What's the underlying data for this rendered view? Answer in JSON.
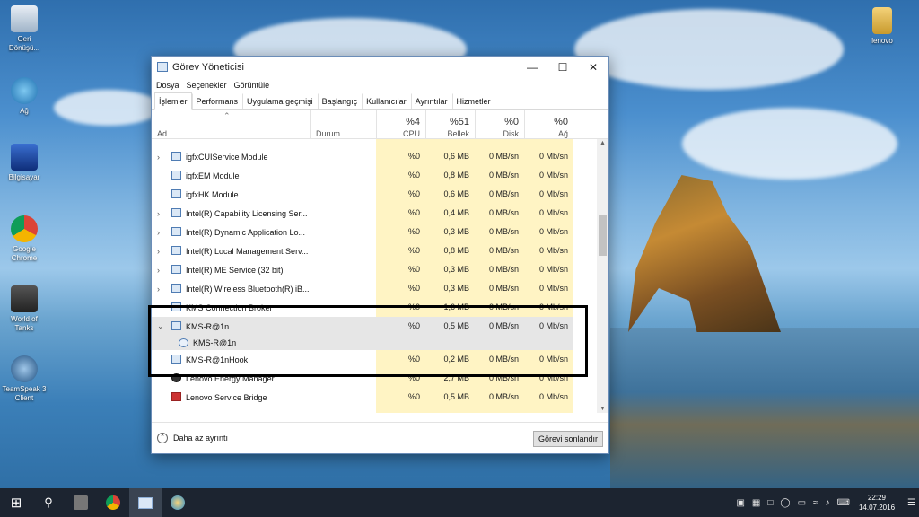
{
  "desktop": {
    "icons_left": [
      {
        "label": "Geri Dönüşü..."
      },
      {
        "label": "Ağ"
      },
      {
        "label": "Bilgisayar"
      },
      {
        "label": "Google Chrome"
      },
      {
        "label": "World of Tanks"
      },
      {
        "label": "TeamSpeak 3 Client"
      }
    ],
    "icon_right": {
      "label": "lenovo"
    }
  },
  "window": {
    "title": "Görev Yöneticisi",
    "menu": [
      "Dosya",
      "Seçenekler",
      "Görüntüle"
    ],
    "tabs": [
      "İşlemler",
      "Performans",
      "Uygulama geçmişi",
      "Başlangıç",
      "Kullanıcılar",
      "Ayrıntılar",
      "Hizmetler"
    ],
    "active_tab": "İşlemler",
    "columns": {
      "name": "Ad",
      "status": "Durum",
      "cpu_pct": "%4",
      "cpu": "CPU",
      "mem_pct": "%51",
      "mem": "Bellek",
      "disk_pct": "%0",
      "disk": "Disk",
      "net_pct": "%0",
      "net": "Ağ"
    },
    "rows": [
      {
        "name": "igfxCUIService Module",
        "cpu": "%0",
        "mem": "0,6 MB",
        "disk": "0 MB/sn",
        "net": "0 Mb/sn"
      },
      {
        "name": "igfxEM Module",
        "cpu": "%0",
        "mem": "0,8 MB",
        "disk": "0 MB/sn",
        "net": "0 Mb/sn"
      },
      {
        "name": "igfxHK Module",
        "cpu": "%0",
        "mem": "0,6 MB",
        "disk": "0 MB/sn",
        "net": "0 Mb/sn"
      },
      {
        "name": "Intel(R) Capability Licensing Ser...",
        "cpu": "%0",
        "mem": "0,4 MB",
        "disk": "0 MB/sn",
        "net": "0 Mb/sn"
      },
      {
        "name": "Intel(R) Dynamic Application Lo...",
        "cpu": "%0",
        "mem": "0,3 MB",
        "disk": "0 MB/sn",
        "net": "0 Mb/sn"
      },
      {
        "name": "Intel(R) Local Management Serv...",
        "cpu": "%0",
        "mem": "0,8 MB",
        "disk": "0 MB/sn",
        "net": "0 Mb/sn"
      },
      {
        "name": "Intel(R) ME Service (32 bit)",
        "cpu": "%0",
        "mem": "0,3 MB",
        "disk": "0 MB/sn",
        "net": "0 Mb/sn"
      },
      {
        "name": "Intel(R) Wireless Bluetooth(R) iB...",
        "cpu": "%0",
        "mem": "0,3 MB",
        "disk": "0 MB/sn",
        "net": "0 Mb/sn"
      },
      {
        "name": "KMS Connection Broker",
        "cpu": "%0",
        "mem": "1,6 MB",
        "disk": "0 MB/sn",
        "net": "0 Mb/sn"
      },
      {
        "name": "KMS-R@1n",
        "cpu": "%0",
        "mem": "0,5 MB",
        "disk": "0 MB/sn",
        "net": "0 Mb/sn"
      },
      {
        "name": "KMS-R@1n",
        "cpu": "",
        "mem": "",
        "disk": "",
        "net": ""
      },
      {
        "name": "KMS-R@1nHook",
        "cpu": "%0",
        "mem": "0,2 MB",
        "disk": "0 MB/sn",
        "net": "0 Mb/sn"
      },
      {
        "name": "Lenovo Energy Manager",
        "cpu": "%0",
        "mem": "2,7 MB",
        "disk": "0 MB/sn",
        "net": "0 Mb/sn"
      },
      {
        "name": "Lenovo Service Bridge",
        "cpu": "%0",
        "mem": "0,5 MB",
        "disk": "0 MB/sn",
        "net": "0 Mb/sn"
      }
    ],
    "footer": {
      "less_details": "Daha az ayrıntı",
      "end_task": "Görevi sonlandır"
    }
  },
  "taskbar": {
    "clock_time": "22:29",
    "clock_date": "14.07.2016"
  }
}
